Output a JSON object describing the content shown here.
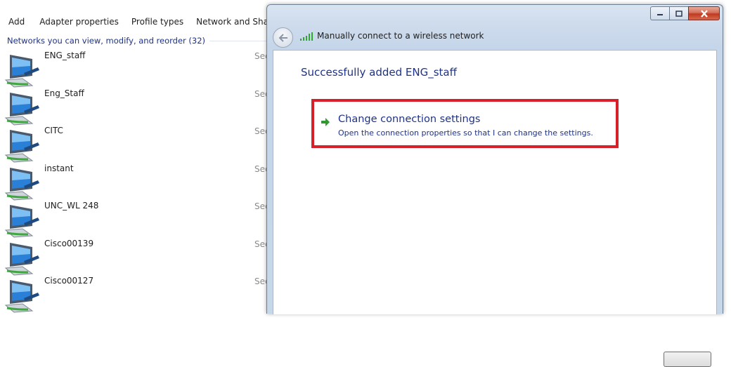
{
  "toolbar": {
    "items": [
      "Add",
      "Adapter properties",
      "Profile types",
      "Network and Sharing"
    ]
  },
  "network_list": {
    "group_header": "Networks you can view, modify, and reorder (32)",
    "items": [
      {
        "name": "ENG_staff",
        "security": "Security"
      },
      {
        "name": "Eng_Staff",
        "security": "Security"
      },
      {
        "name": "CITC",
        "security": "Security"
      },
      {
        "name": "instant",
        "security": "Security"
      },
      {
        "name": "UNC_WL 248",
        "security": "Security"
      },
      {
        "name": "Cisco00139",
        "security": "Security"
      },
      {
        "name": "Cisco00127",
        "security": "Security"
      }
    ]
  },
  "dialog": {
    "title": "Manually connect to a wireless network",
    "success_message": "Successfully added ENG_staff",
    "command_link": {
      "title": "Change connection settings",
      "description": "Open the connection properties so that I can change the settings."
    },
    "caption_buttons": [
      "minimize",
      "maximize",
      "close"
    ]
  },
  "colors": {
    "link_blue": "#1e3287",
    "highlight_red": "#d8202a",
    "arrow_green": "#2e9a2e"
  },
  "icons": {
    "network": "wireless-network-icon",
    "back": "back-arrow-icon",
    "signal": "wifi-signal-icon",
    "command": "green-arrow-icon"
  }
}
